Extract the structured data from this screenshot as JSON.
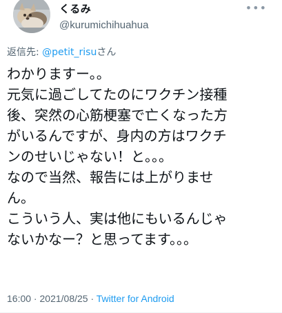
{
  "author": {
    "display_name": "くるみ",
    "username": "@kurumichihuahua",
    "avatar_icon": "chihuahua-avatar-icon"
  },
  "more_icon": "more-options-icon",
  "more_glyph": "•••",
  "reply": {
    "prefix": "返信先: ",
    "mention": "@petit_risu",
    "suffix": "さん"
  },
  "tweet": {
    "lines": [
      "わかりますー。。",
      "元気に過ごしてたのにワクチン接種",
      "後、突然の心筋梗塞で亡くなった方",
      "がいるんですが、身内の方はワクチ",
      "ンのせいじゃない！と。。。",
      "なので当然、報告には上がりませ",
      "ん。",
      "こういう人、実は他にもいるんじゃ",
      "ないかなー？と思ってます。。。"
    ]
  },
  "meta": {
    "time": "16:00",
    "separator": " · ",
    "date": "2021/08/25",
    "source": "Twitter for Android"
  },
  "colors": {
    "text": "#0f1419",
    "secondary": "#536471",
    "link": "#1d9bf0"
  }
}
